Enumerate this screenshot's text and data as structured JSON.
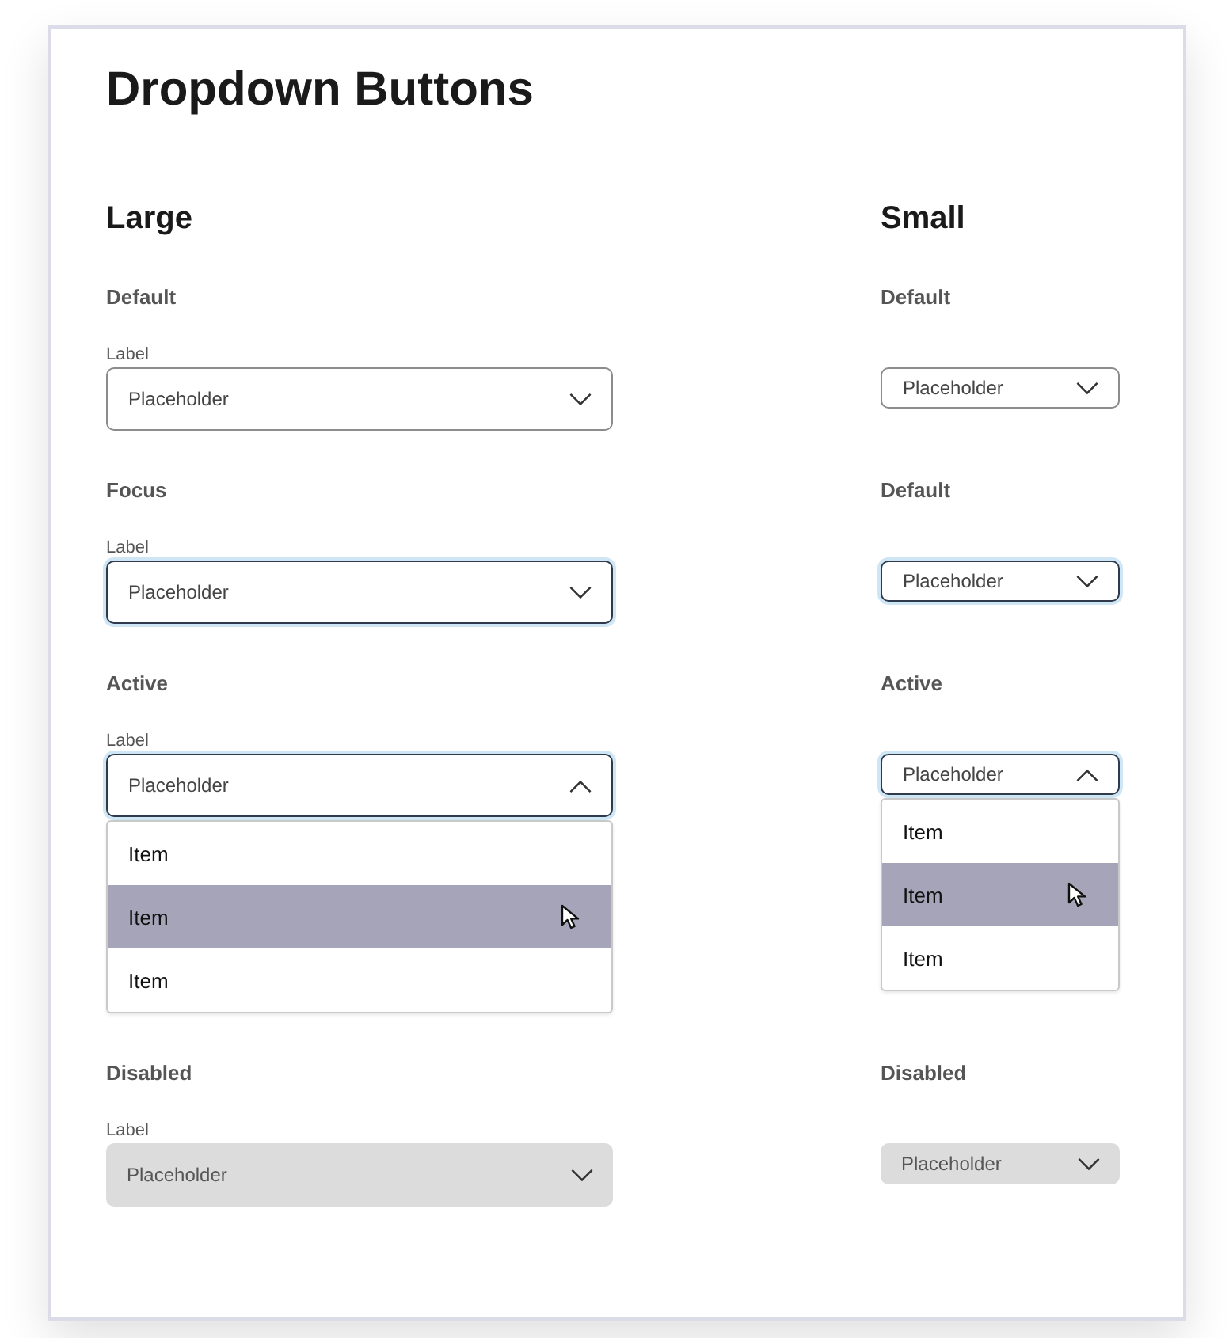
{
  "title": "Dropdown Buttons",
  "columns": [
    {
      "heading": "Large",
      "kind": "large",
      "sections": [
        {
          "title": "Default",
          "label": "Label",
          "kind": "default",
          "placeholder": "Placeholder"
        },
        {
          "title": "Focus",
          "label": "Label",
          "kind": "focus",
          "placeholder": "Placeholder"
        },
        {
          "title": "Active",
          "label": "Label",
          "kind": "active",
          "placeholder": "Placeholder",
          "items": [
            {
              "text": "Item",
              "selected": false
            },
            {
              "text": "Item",
              "selected": true
            },
            {
              "text": "Item",
              "selected": false
            }
          ]
        },
        {
          "title": "Disabled",
          "label": "Label",
          "kind": "disabled",
          "placeholder": "Placeholder"
        }
      ]
    },
    {
      "heading": "Small",
      "kind": "small",
      "sections": [
        {
          "title": "Default",
          "kind": "default",
          "placeholder": "Placeholder"
        },
        {
          "title": "Default",
          "kind": "focus",
          "placeholder": "Placeholder"
        },
        {
          "title": "Active",
          "kind": "active",
          "placeholder": "Placeholder",
          "items": [
            {
              "text": "Item",
              "selected": false
            },
            {
              "text": "Item",
              "selected": true
            },
            {
              "text": "Item",
              "selected": false
            }
          ]
        },
        {
          "title": "Disabled",
          "kind": "disabled",
          "placeholder": "Placeholder"
        }
      ]
    }
  ]
}
